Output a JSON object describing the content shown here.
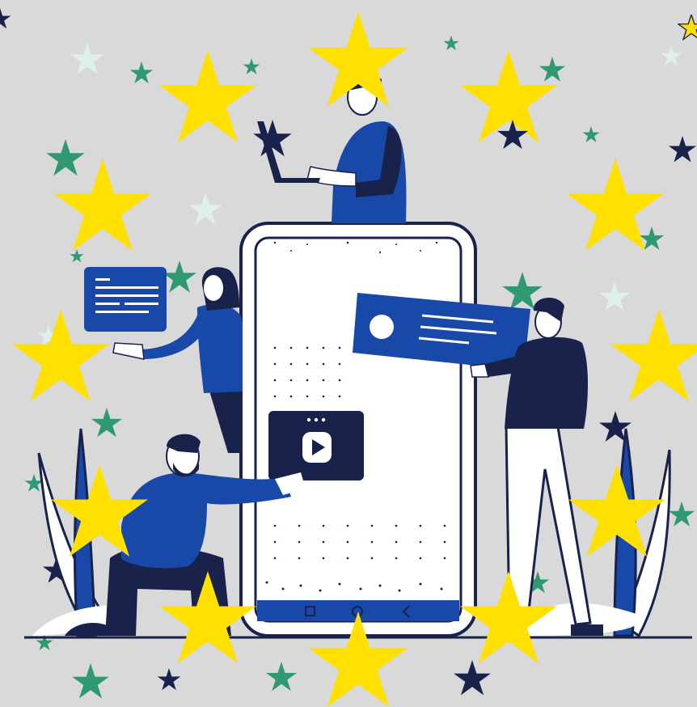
{
  "image": {
    "description_visible_text": "",
    "ui_controls": {
      "phone_nav": [
        "square-icon",
        "circle-icon",
        "back-chevron-icon"
      ],
      "video_card": [
        "more-dots-icon",
        "play-icon"
      ],
      "message_card": [
        "avatar-circle",
        "text-lines"
      ],
      "chat_bubble": [
        "text-lines"
      ]
    }
  },
  "colors": {
    "background": "#d9d9d9",
    "gold_star": "#ffe000",
    "teal_star": "#2f9a72",
    "navy": "#18224a",
    "royal_blue": "#1848a8",
    "mint_star": "#dff0e8",
    "white": "#ffffff",
    "skin": "#ffffff"
  }
}
